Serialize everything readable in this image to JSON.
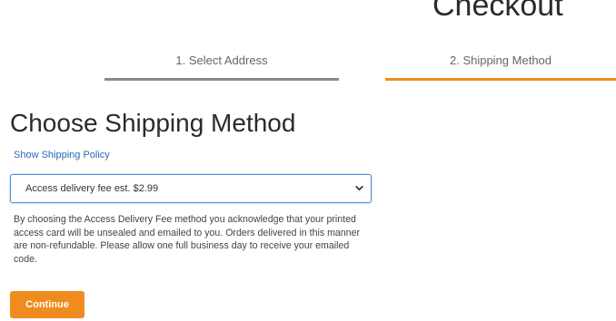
{
  "header": {
    "title": "Checkout"
  },
  "steps": [
    {
      "label": "1. Select Address",
      "state": "complete"
    },
    {
      "label": "2. Shipping Method",
      "state": "active"
    }
  ],
  "main": {
    "title": "Choose Shipping Method",
    "policy_link": "Show Shipping Policy",
    "shipping_select": {
      "selected": "Access delivery fee est. $2.99"
    },
    "notice": "By choosing the Access Delivery Fee method you acknowledge that your printed access card will be unsealed and emailed to you. Orders delivered in this manner are non-refundable. Please allow one full business day to receive your emailed code.",
    "continue_label": "Continue"
  },
  "colors": {
    "accent": "#f08c1e",
    "link": "#2a6ab5",
    "step_inactive": "#8a8a8a",
    "focus": "#4a90d9"
  },
  "icons": {
    "select_chevron": "chevron-down-icon"
  }
}
